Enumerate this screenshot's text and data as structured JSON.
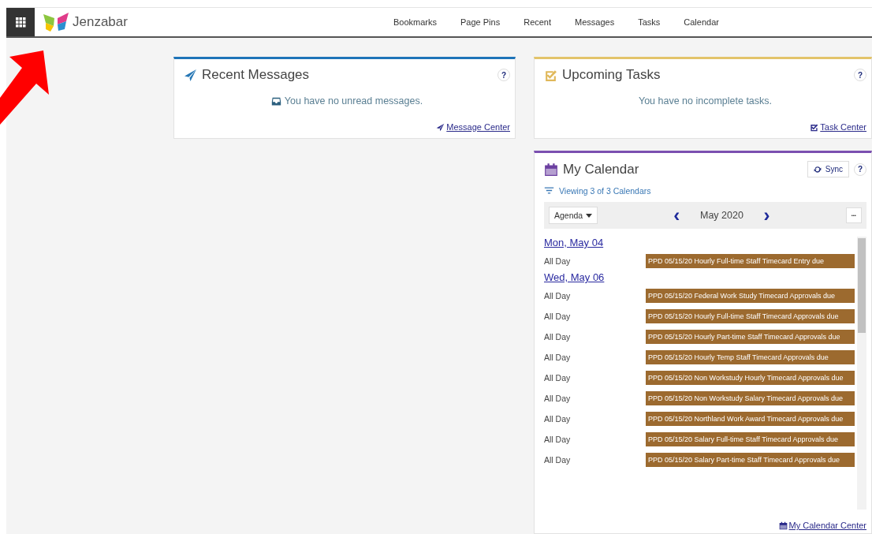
{
  "header": {
    "brand": "Jenzabar",
    "nav": [
      "Bookmarks",
      "Page Pins",
      "Recent",
      "Messages",
      "Tasks",
      "Calendar"
    ]
  },
  "messages": {
    "title": "Recent Messages",
    "help": "?",
    "empty": "You have no unread messages.",
    "link": "Message Center"
  },
  "tasks": {
    "title": "Upcoming Tasks",
    "help": "?",
    "empty": "You have no incomplete tasks.",
    "link": "Task Center"
  },
  "calendar": {
    "title": "My Calendar",
    "sync": "Sync",
    "help": "?",
    "filter": "Viewing 3 of 3 Calendars",
    "view": "Agenda",
    "prev": "‹",
    "month": "May 2020",
    "next": "›",
    "more": "•••",
    "days": [
      {
        "date": "Mon, May 04",
        "events": [
          {
            "time": "All Day",
            "title": "PPD 05/15/20 Hourly Full-time Staff Timecard Entry due",
            "color": "#9c6a2f"
          }
        ]
      },
      {
        "date": "Wed, May 06",
        "events": [
          {
            "time": "All Day",
            "title": "PPD 05/15/20 Federal Work Study Timecard Approvals due",
            "color": "#9c6a2f"
          },
          {
            "time": "All Day",
            "title": "PPD 05/15/20 Hourly Full-time Staff Timecard Approvals due",
            "color": "#9c6a2f"
          },
          {
            "time": "All Day",
            "title": "PPD 05/15/20 Hourly Part-time Staff Timecard Approvals due",
            "color": "#9c6a2f"
          },
          {
            "time": "All Day",
            "title": "PPD 05/15/20 Hourly Temp Staff Timecard Approvals due",
            "color": "#9c6a2f"
          },
          {
            "time": "All Day",
            "title": "PPD 05/15/20 Non Workstudy Hourly Timecard Approvals due",
            "color": "#9c6a2f"
          },
          {
            "time": "All Day",
            "title": "PPD 05/15/20 Non Workstudy Salary Timecard Approvals due",
            "color": "#9c6a2f"
          },
          {
            "time": "All Day",
            "title": "PPD 05/15/20 Northland Work Award Timecard Approvals due",
            "color": "#9c6a2f"
          },
          {
            "time": "All Day",
            "title": "PPD 05/15/20 Salary Full-time Staff Timecard Approvals due",
            "color": "#9c6a2f"
          },
          {
            "time": "All Day",
            "title": "PPD 05/15/20 Salary Part-time Staff Timecard Approvals due",
            "color": "#9c6a2f"
          }
        ]
      }
    ],
    "link": "My Calendar Center"
  }
}
